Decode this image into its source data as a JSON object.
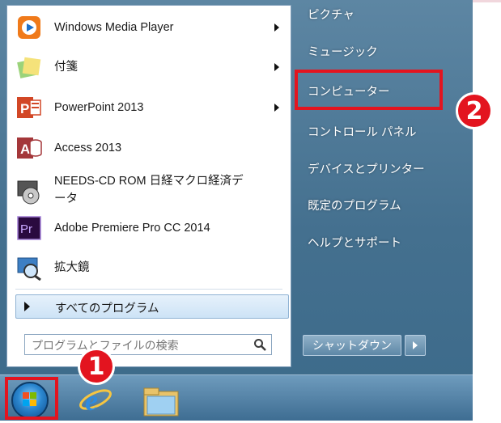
{
  "programs": [
    {
      "label": "Windows Media Player",
      "has_submenu": true,
      "icon": "media-player-icon"
    },
    {
      "label": "付箋",
      "has_submenu": true,
      "icon": "sticky-notes-icon"
    },
    {
      "label": "PowerPoint 2013",
      "has_submenu": true,
      "icon": "powerpoint-icon"
    },
    {
      "label": "Access 2013",
      "has_submenu": false,
      "icon": "access-icon"
    },
    {
      "label_line1": "NEEDS-CD ROM 日経マクロ経済デ",
      "label_line2": "ータ",
      "has_submenu": false,
      "icon": "cd-rom-icon"
    },
    {
      "label": "Adobe Premiere Pro CC 2014",
      "has_submenu": false,
      "icon": "premiere-icon"
    },
    {
      "label": "拡大鏡",
      "has_submenu": false,
      "icon": "magnifier-icon"
    }
  ],
  "all_programs": {
    "label": "すべてのプログラム"
  },
  "search": {
    "placeholder": "プログラムとファイルの検索"
  },
  "right_links": [
    "ピクチャ",
    "ミュージック",
    "コンピューター",
    "コントロール パネル",
    "デバイスとプリンター",
    "既定のプログラム",
    "ヘルプとサポート"
  ],
  "shutdown": {
    "label": "シャットダウン"
  },
  "annotations": {
    "step1": "1",
    "step2": "2",
    "color": "#e3141f"
  },
  "taskbar": {
    "items": [
      "start-orb-icon",
      "internet-explorer-icon",
      "file-explorer-icon"
    ]
  }
}
